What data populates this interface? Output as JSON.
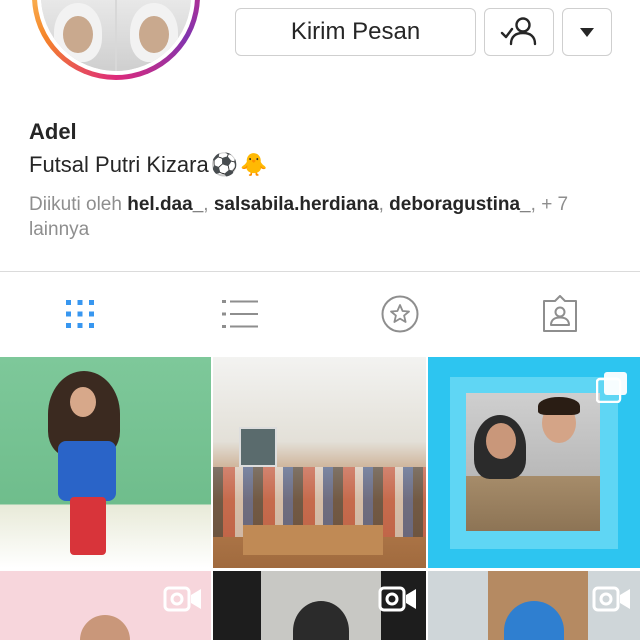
{
  "profile": {
    "name": "Adel",
    "bio": "Futsal Putri Kizara",
    "bio_emoji_1": "⚽",
    "bio_emoji_2": "🐥",
    "followed_by_prefix": "Diikuti oleh ",
    "followed_by": [
      "hel.daa_",
      "salsabila.herdiana",
      "deboragustina_"
    ],
    "sep_1": ", ",
    "sep_2": ", ",
    "sep_3": ", ",
    "followed_by_suffix": "+ 7 lainnya"
  },
  "actions": {
    "message_label": "Kirim Pesan",
    "following_icon": "person-check-icon",
    "dropdown_icon": "caret-down-icon"
  },
  "tabs": [
    {
      "name": "grid",
      "icon": "grid-icon",
      "active": true
    },
    {
      "name": "list",
      "icon": "list-icon",
      "active": false
    },
    {
      "name": "saved",
      "icon": "star-circle-icon",
      "active": false
    },
    {
      "name": "tagged",
      "icon": "tagged-person-icon",
      "active": false
    }
  ],
  "posts": [
    {
      "type": "photo"
    },
    {
      "type": "photo"
    },
    {
      "type": "carousel",
      "badge_icon": "multiple-photos-icon"
    },
    {
      "type": "video",
      "badge_icon": "video-camera-icon"
    },
    {
      "type": "video",
      "badge_icon": "video-camera-icon"
    },
    {
      "type": "video",
      "badge_icon": "video-camera-icon"
    }
  ],
  "colors": {
    "active_tab": "#3897f0",
    "inactive_icon": "#8e8e8e",
    "text_primary": "#262626",
    "text_secondary": "#8e8e8e",
    "border": "#dbdbdb"
  }
}
